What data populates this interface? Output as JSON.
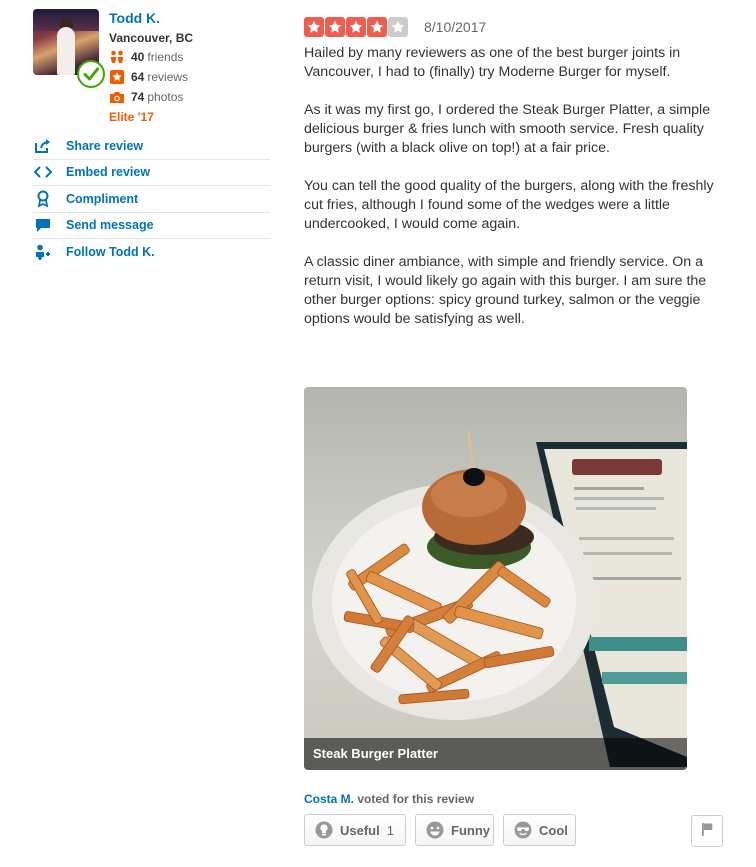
{
  "user": {
    "name": "Todd K.",
    "location": "Vancouver, BC",
    "friends_count": "40",
    "friends_label": "friends",
    "reviews_count": "64",
    "reviews_label": "reviews",
    "photos_count": "74",
    "photos_label": "photos",
    "elite": "Elite '17"
  },
  "actions": [
    {
      "label": "Share review",
      "icon": "share-icon"
    },
    {
      "label": "Embed review",
      "icon": "embed-icon"
    },
    {
      "label": "Compliment",
      "icon": "compliment-icon"
    },
    {
      "label": "Send message",
      "icon": "message-icon"
    },
    {
      "label": "Follow Todd K.",
      "icon": "follow-icon"
    }
  ],
  "review": {
    "rating": 4,
    "rating_max": 5,
    "date": "8/10/2017",
    "paragraphs": [
      "Hailed by many reviewers as one of the best burger joints in Vancouver, I had to (finally) try Moderne Burger for myself.",
      "As it was my first go, I ordered the Steak Burger Platter, a simple delicious burger & fries lunch with smooth service.  Fresh quality burgers (with a black olive on top!) at a fair price.",
      "You can tell the good quality of the burgers, along with the freshly cut fries, although I found some of the wedges were a little undercooked, I would come again.",
      "A classic diner ambiance, with simple and friendly service. On a return visit, I would likely go again with this burger.  I am sure the other burger options: spicy ground turkey, salmon or the veggie options would be satisfying as well."
    ],
    "photo_caption": "Steak Burger Platter",
    "voter": "Costa M.",
    "voted_text": "voted for this review"
  },
  "votes": {
    "useful_label": "Useful",
    "useful_count": "1",
    "funny_label": "Funny",
    "cool_label": "Cool"
  },
  "colors": {
    "link": "#0073bb",
    "star_on": "#f15c4f",
    "star_off": "#cccccc",
    "elite": "#f15c00"
  }
}
